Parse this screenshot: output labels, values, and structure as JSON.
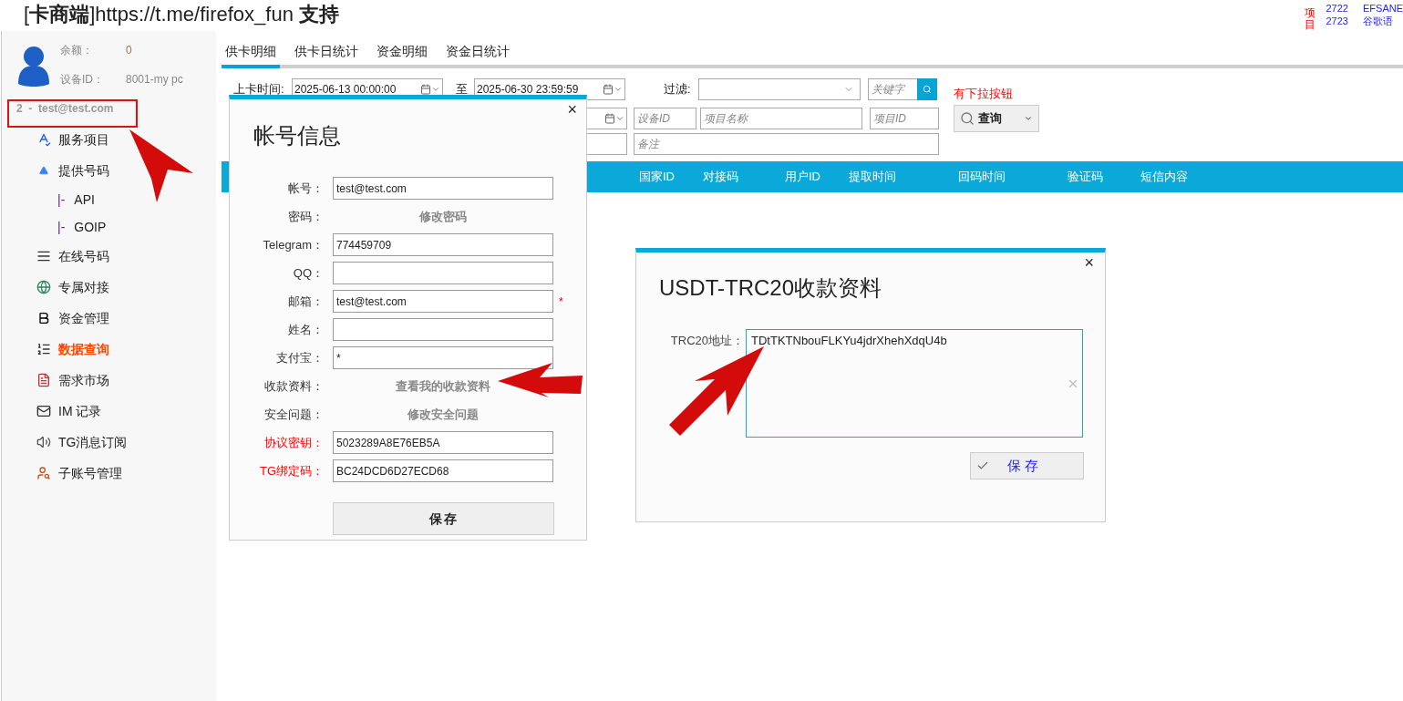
{
  "header": {
    "title": "[**卡商端**]https://t.me/firefox_fun **支持**",
    "notice": {
      "label": "项目",
      "rows": [
        {
          "id": "2722",
          "name": "EFSANE"
        },
        {
          "id": "2723",
          "name": "谷歌语"
        }
      ]
    }
  },
  "account": {
    "balance_label": "余额：",
    "balance": "0",
    "device_label": "设备ID：",
    "device": "8001-my pc",
    "user": "2  -  test@test.com"
  },
  "sidebar": {
    "items": [
      {
        "label": "服务项目",
        "selected": false
      },
      {
        "label": "提供号码",
        "selected": false,
        "children": [
          {
            "prefix": "|-",
            "label": "API",
            "selected": false
          },
          {
            "prefix": "|-",
            "label": "GOIP",
            "selected": false
          }
        ]
      },
      {
        "label": "在线号码",
        "selected": false
      },
      {
        "label": "专属对接",
        "selected": false
      },
      {
        "label": "资金管理",
        "selected": false
      },
      {
        "label": "数据查询",
        "selected": true
      },
      {
        "label": "需求市场",
        "selected": false
      },
      {
        "label": "IM 记录",
        "selected": false
      },
      {
        "label": "TG消息订阅",
        "selected": false
      },
      {
        "label": "子账号管理",
        "selected": false
      }
    ]
  },
  "tabs": [
    {
      "label": "供卡明细",
      "selected": true
    },
    {
      "label": "供卡日统计",
      "selected": false
    },
    {
      "label": "资金明细",
      "selected": false
    },
    {
      "label": "资金日统计",
      "selected": false
    }
  ],
  "filters": {
    "time_label": "上卡时间:",
    "start": "2025-06-13 00:00:00",
    "to_label": "至",
    "end": "2025-06-30 23:59:59",
    "filter_label": "过滤:",
    "keyword_placeholder": "关键字",
    "hint": "有下拉按钮",
    "device_placeholder": "设备ID",
    "project_placeholder": "项目名称",
    "project_id_placeholder": "项目ID",
    "query": "查询",
    "remark_placeholder": "备注"
  },
  "table": {
    "columns": [
      "国家ID",
      "对接码",
      "用户ID",
      "提取时间",
      "回码时间",
      "验证码",
      "短信内容"
    ]
  },
  "account_dialog": {
    "title": "帐号信息",
    "close": "×",
    "save": "保存",
    "fields": [
      {
        "kind": "input",
        "label": "帐号：",
        "value": "test@test.com",
        "emphasized": false
      },
      {
        "kind": "link",
        "label": "密码：",
        "value": "修改密码",
        "emphasized": false
      },
      {
        "kind": "input",
        "label": "Telegram：",
        "value": "774459709",
        "emphasized": false
      },
      {
        "kind": "input",
        "label": "QQ：",
        "emphasized": false
      },
      {
        "kind": "input",
        "label": "邮箱：",
        "value": "test@test.com",
        "emphasized": false,
        "mark": "*"
      },
      {
        "kind": "input",
        "label": "姓名：",
        "emphasized": false
      },
      {
        "kind": "input",
        "label": "支付宝：",
        "value": "*",
        "emphasized": false
      },
      {
        "kind": "link",
        "label": "收款资料：",
        "value": "查看我的收款资料",
        "emphasized": false
      },
      {
        "kind": "link",
        "label": "安全问题：",
        "value": "修改安全问题",
        "emphasized": false
      },
      {
        "kind": "input",
        "label": "协议密钥：",
        "value": "5023289A8E76EB5A",
        "emphasized": true
      },
      {
        "kind": "input",
        "label": "TG绑定码：",
        "value": "BC24DCD6D27ECD68",
        "emphasized": true
      }
    ]
  },
  "payment_dialog": {
    "title": "USDT-TRC20收款资料",
    "close": "×",
    "address_label": "TRC20地址：",
    "address": "TDtTKTNbouFLKYu4jdrXhehXdqU4b",
    "save": "保 存"
  }
}
